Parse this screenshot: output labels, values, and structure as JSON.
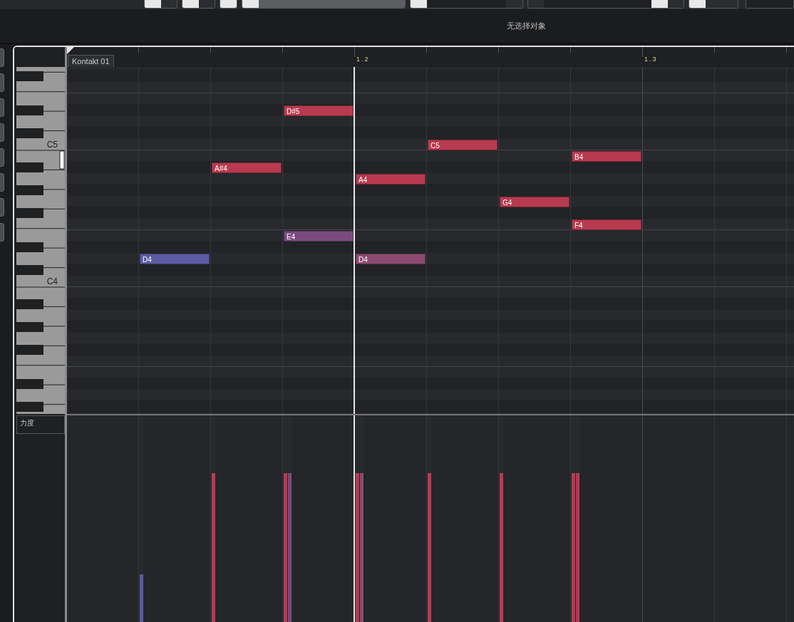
{
  "info_line": "无选择对象",
  "ruler": {
    "part_name": "Kontakt 01",
    "markers": [
      "1.2",
      "1.3"
    ]
  },
  "keyboard": {
    "labels": [
      "C5",
      "C4"
    ]
  },
  "steps": [
    {
      "notes": [
        {
          "label": "D4",
          "color": "#5b5ba3",
          "level": 0.23
        }
      ]
    },
    {
      "notes": [
        {
          "label": "A#4",
          "color": "#b83a4f",
          "level": 0.72
        }
      ]
    },
    {
      "notes": [
        {
          "label": "D#5",
          "color": "#b83a4f",
          "level": 0.72
        },
        {
          "label": "E4",
          "color": "#7b4b80",
          "level": 0.72
        }
      ]
    },
    {
      "notes": [
        {
          "label": "A4",
          "color": "#b83a4f",
          "level": 0.72
        },
        {
          "label": "D4",
          "color": "#8d4a70",
          "level": 0.72
        }
      ]
    },
    {
      "notes": [
        {
          "label": "C5",
          "color": "#b83a4f",
          "level": 0.72
        }
      ]
    },
    {
      "notes": [
        {
          "label": "G4",
          "color": "#b83a4f",
          "level": 0.72
        }
      ]
    },
    {
      "notes": [
        {
          "label": "B4",
          "color": "#b83a4f",
          "level": 0.72
        },
        {
          "label": "F4",
          "color": "#b83a4f",
          "level": 0.72
        }
      ]
    }
  ],
  "controller_lane": {
    "label": "力度"
  }
}
